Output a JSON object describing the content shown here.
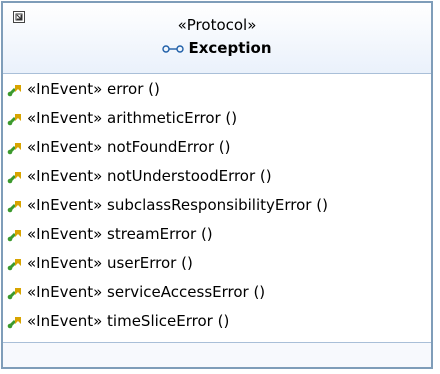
{
  "diagram": {
    "stereotype": "«Protocol»",
    "name": "Exception",
    "colors": {
      "border": "#7f9db9",
      "header_bg": "#eaf1fb",
      "operation_icon_green": "#3c9a2e",
      "operation_icon_gold": "#d8a400"
    },
    "operations": [
      {
        "stereotype": "«InEvent»",
        "name": "error ()"
      },
      {
        "stereotype": "«InEvent»",
        "name": "arithmeticError ()"
      },
      {
        "stereotype": "«InEvent»",
        "name": "notFoundError ()"
      },
      {
        "stereotype": "«InEvent»",
        "name": "notUnderstoodError ()"
      },
      {
        "stereotype": "«InEvent»",
        "name": "subclassResponsibilityError ()"
      },
      {
        "stereotype": "«InEvent»",
        "name": "streamError ()"
      },
      {
        "stereotype": "«InEvent»",
        "name": "userError ()"
      },
      {
        "stereotype": "«InEvent»",
        "name": "serviceAccessError ()"
      },
      {
        "stereotype": "«InEvent»",
        "name": "timeSliceError ()"
      }
    ]
  }
}
